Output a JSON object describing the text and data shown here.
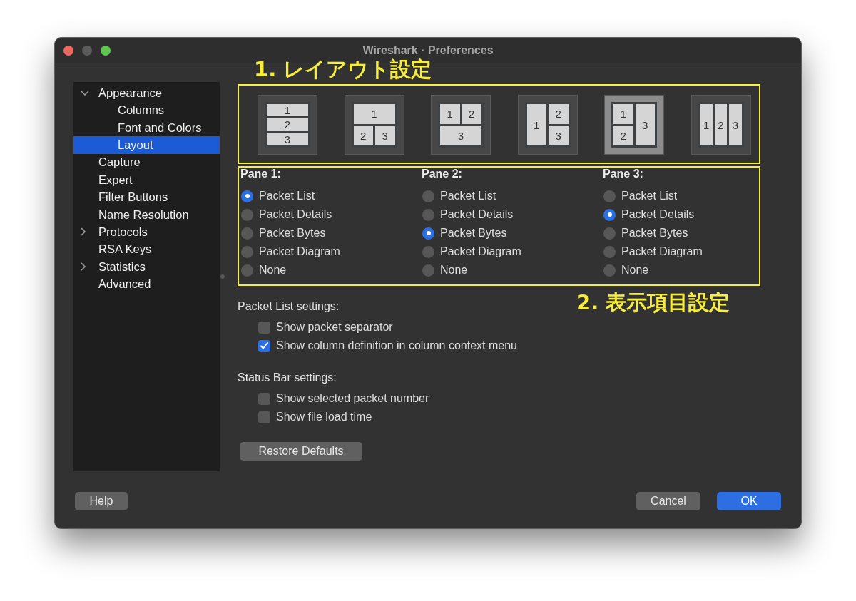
{
  "window": {
    "title": "Wireshark · Preferences",
    "controls": [
      {
        "kind": "close",
        "disabled": false
      },
      {
        "kind": "minimize",
        "disabled": true
      },
      {
        "kind": "zoom",
        "disabled": false
      }
    ]
  },
  "annotations": [
    {
      "text": "1. レイアウト設定"
    },
    {
      "text": "2. 表示項目設定"
    }
  ],
  "sidebar": {
    "items": [
      {
        "label": "Appearance",
        "expanded": true,
        "selected": false,
        "children": [
          {
            "label": "Columns",
            "selected": false
          },
          {
            "label": "Font and Colors",
            "selected": false
          },
          {
            "label": "Layout",
            "selected": true
          }
        ]
      },
      {
        "label": "Capture",
        "selected": false
      },
      {
        "label": "Expert",
        "selected": false
      },
      {
        "label": "Filter Buttons",
        "selected": false
      },
      {
        "label": "Name Resolution",
        "selected": false
      },
      {
        "label": "Protocols",
        "expanded": false,
        "selected": false
      },
      {
        "label": "RSA Keys",
        "selected": false
      },
      {
        "label": "Statistics",
        "expanded": false,
        "selected": false
      },
      {
        "label": "Advanced",
        "selected": false
      }
    ]
  },
  "layout_options": [
    {
      "kind": "rows",
      "panes": [
        "1",
        "2",
        "3"
      ],
      "selected": false
    },
    {
      "kind": "top-wide",
      "panes": [
        "1",
        "2",
        "3"
      ],
      "selected": false
    },
    {
      "kind": "bottom-wide",
      "panes": [
        "1",
        "2",
        "3"
      ],
      "selected": false
    },
    {
      "kind": "left-tall",
      "panes": [
        "1",
        "2",
        "3"
      ],
      "selected": false
    },
    {
      "kind": "right-tall",
      "panes": [
        "1",
        "2",
        "3"
      ],
      "selected": true
    },
    {
      "kind": "columns",
      "panes": [
        "1",
        "2",
        "3"
      ],
      "selected": false
    }
  ],
  "panes": [
    {
      "title": "Pane 1:",
      "options": [
        {
          "label": "Packet List",
          "selected": true
        },
        {
          "label": "Packet Details",
          "selected": false
        },
        {
          "label": "Packet Bytes",
          "selected": false
        },
        {
          "label": "Packet Diagram",
          "selected": false
        },
        {
          "label": "None",
          "selected": false
        }
      ]
    },
    {
      "title": "Pane 2:",
      "options": [
        {
          "label": "Packet List",
          "selected": false
        },
        {
          "label": "Packet Details",
          "selected": false
        },
        {
          "label": "Packet Bytes",
          "selected": true
        },
        {
          "label": "Packet Diagram",
          "selected": false
        },
        {
          "label": "None",
          "selected": false
        }
      ]
    },
    {
      "title": "Pane 3:",
      "options": [
        {
          "label": "Packet List",
          "selected": false
        },
        {
          "label": "Packet Details",
          "selected": true
        },
        {
          "label": "Packet Bytes",
          "selected": false
        },
        {
          "label": "Packet Diagram",
          "selected": false
        },
        {
          "label": "None",
          "selected": false
        }
      ]
    }
  ],
  "settings_groups": [
    {
      "title": "Packet List settings:",
      "options": [
        {
          "label": "Show packet separator",
          "checked": false
        },
        {
          "label": "Show column definition in column context menu",
          "checked": true
        }
      ]
    },
    {
      "title": "Status Bar settings:",
      "options": [
        {
          "label": "Show selected packet number",
          "checked": false
        },
        {
          "label": "Show file load time",
          "checked": false
        }
      ]
    }
  ],
  "restore_button": {
    "label": "Restore Defaults"
  },
  "footer": {
    "left": [
      {
        "label": "Help",
        "kind": "normal"
      }
    ],
    "right": [
      {
        "label": "Cancel",
        "kind": "normal"
      },
      {
        "label": "OK",
        "kind": "primary"
      }
    ]
  }
}
